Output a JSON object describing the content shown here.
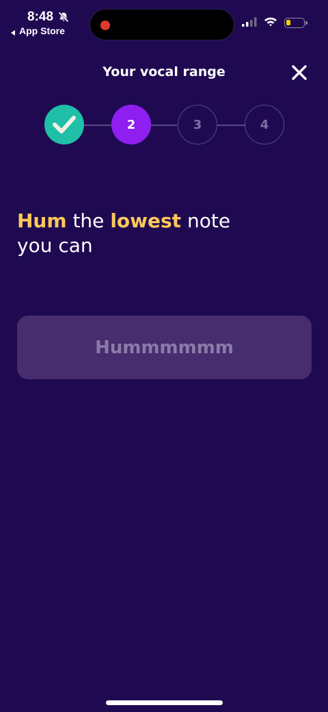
{
  "status_bar": {
    "time": "8:48",
    "back_label": "App Store",
    "icons": [
      "bell-muted-icon",
      "signal-icon",
      "wifi-icon",
      "battery-icon"
    ],
    "battery_level": 0.25,
    "recording_color": "#e0392b",
    "battery_color": "#f5d000"
  },
  "header": {
    "title": "Your vocal range",
    "close_icon": "close-icon"
  },
  "stepper": {
    "steps": [
      {
        "label": "",
        "state": "completed",
        "icon": "check-icon"
      },
      {
        "label": "2",
        "state": "active"
      },
      {
        "label": "3",
        "state": "pending"
      },
      {
        "label": "4",
        "state": "pending"
      }
    ],
    "completed_color": "#1fbfa8",
    "active_color": "#8e1ff0"
  },
  "prompt": {
    "word1": "Hum",
    "word2": " the ",
    "word3": "lowest",
    "word4": " note",
    "line2": "you can",
    "highlight_color": "#ffc85a"
  },
  "hum_box": {
    "label": "Hummmmmm"
  },
  "colors": {
    "background": "#1f0a52",
    "hum_box_bg": "#472d6e",
    "hum_box_text": "#8c7ba8"
  }
}
